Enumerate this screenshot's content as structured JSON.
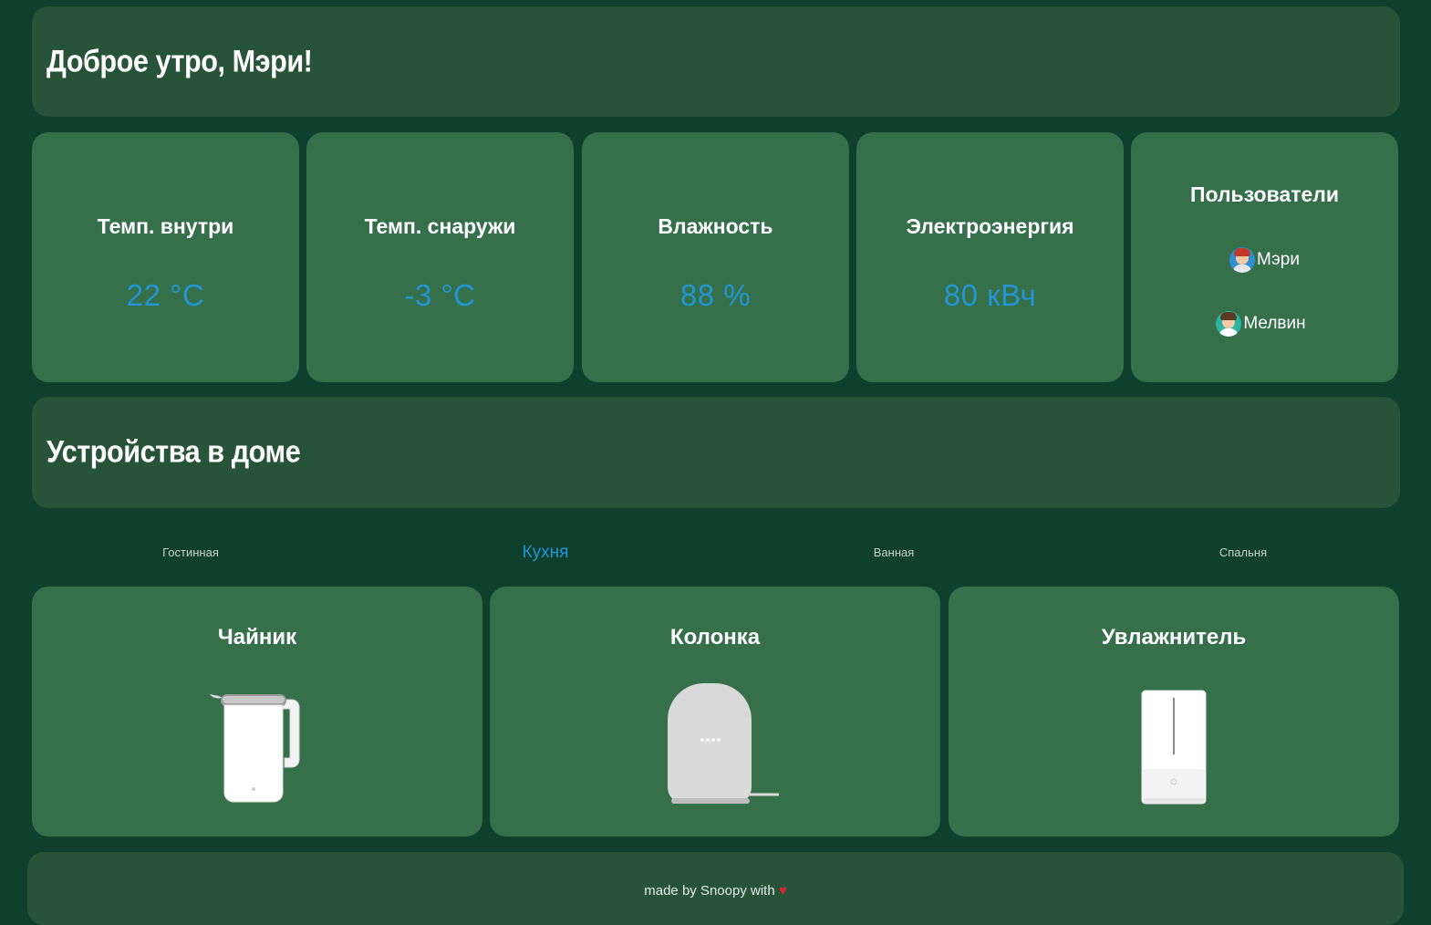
{
  "greeting": {
    "title": "Доброе утро, Мэри!"
  },
  "stats": [
    {
      "label": "Темп. внутри",
      "value": "22 °C"
    },
    {
      "label": "Темп. снаружи",
      "value": "-3 °C"
    },
    {
      "label": "Влажность",
      "value": "88 %"
    },
    {
      "label": "Электроэнергия",
      "value": "80 кВч"
    }
  ],
  "users": {
    "title": "Пользователи",
    "list": [
      {
        "name": "Мэри",
        "icon": "avatar-female-icon"
      },
      {
        "name": "Мелвин",
        "icon": "avatar-male-icon"
      }
    ]
  },
  "devices_section": {
    "title": "Устройства в доме"
  },
  "tabs": [
    {
      "label": "Гостинная",
      "active": false
    },
    {
      "label": "Кухня",
      "active": true
    },
    {
      "label": "Ванная",
      "active": false
    },
    {
      "label": "Спальня",
      "active": false
    }
  ],
  "devices": [
    {
      "name": "Чайник",
      "icon": "kettle-icon"
    },
    {
      "name": "Колонка",
      "icon": "smart-speaker-icon"
    },
    {
      "name": "Увлажнитель",
      "icon": "humidifier-icon"
    }
  ],
  "footer": {
    "text": "made by Snoopy with",
    "heart": "♥"
  },
  "colors": {
    "background": "#0f3f2d",
    "panel": "#275438",
    "card": "#35704a",
    "accent": "#2196d3",
    "heart": "#d6262e"
  }
}
